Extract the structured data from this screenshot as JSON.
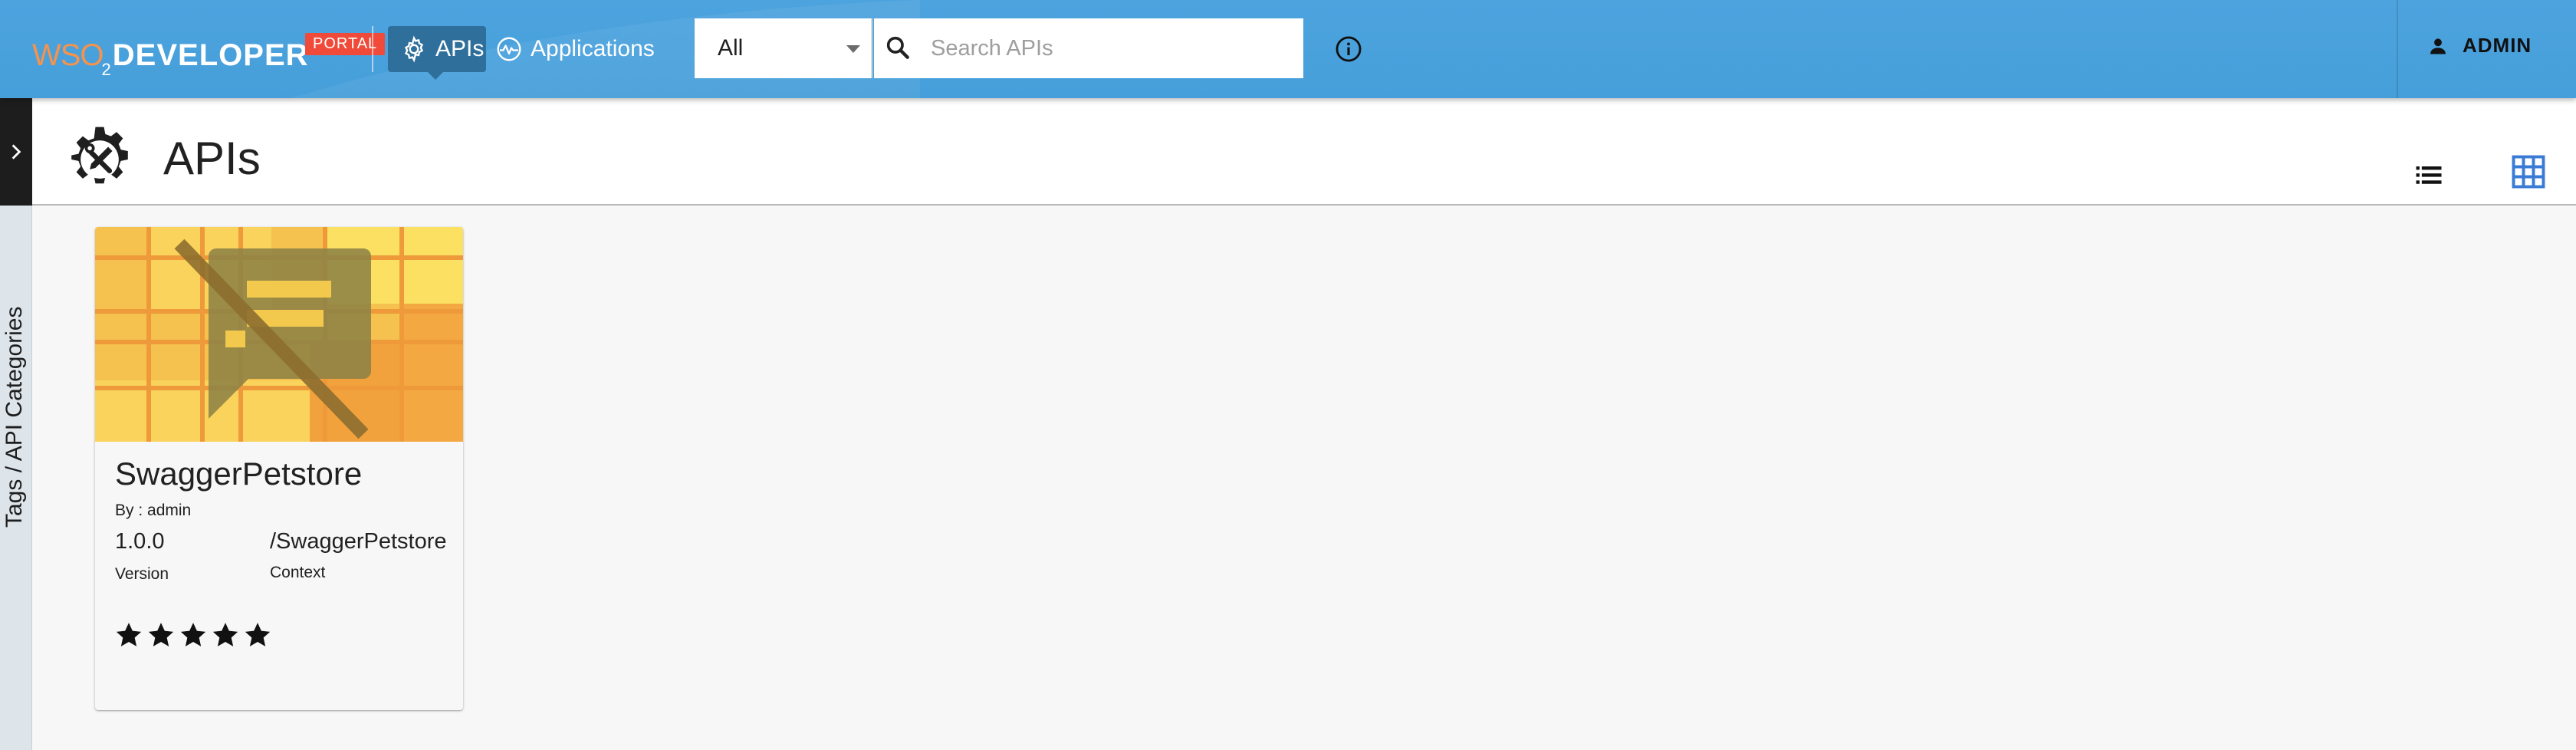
{
  "header": {
    "logo": {
      "prefix": "WSO",
      "subscript": "2",
      "name": "DEVELOPER",
      "badge": "PORTAL"
    },
    "nav": [
      {
        "label": "APIs",
        "icon": "gear-icon",
        "active": true
      },
      {
        "label": "Applications",
        "icon": "pulse-icon",
        "active": false
      }
    ],
    "search": {
      "filter_value": "All",
      "placeholder": "Search APIs"
    },
    "info_icon": "info-icon",
    "user": {
      "label": "ADMIN",
      "icon": "person-icon"
    }
  },
  "sidebar": {
    "label": "Tags / API Categories",
    "toggle_icon": "chevron-right-icon"
  },
  "page": {
    "title": "APIs",
    "title_icon": "apis-gear-tools-icon",
    "views": [
      {
        "name": "list",
        "icon": "list-icon"
      },
      {
        "name": "grid",
        "icon": "grid-icon",
        "active": true
      }
    ]
  },
  "apis": [
    {
      "name": "SwaggerPetstore",
      "by": "By : admin",
      "version": "1.0.0",
      "version_label": "Version",
      "context": "/SwaggerPetstore",
      "context_label": "Context",
      "rating_stars": 5,
      "thumbnail_icon": "no-image-icon"
    }
  ],
  "colors": {
    "header": "#4aa1dc",
    "active_nav": "#2f6f9b",
    "badge": "#f04b3a",
    "logo_accent": "#f5934d",
    "grid_icon_active": "#3a7bd5"
  }
}
